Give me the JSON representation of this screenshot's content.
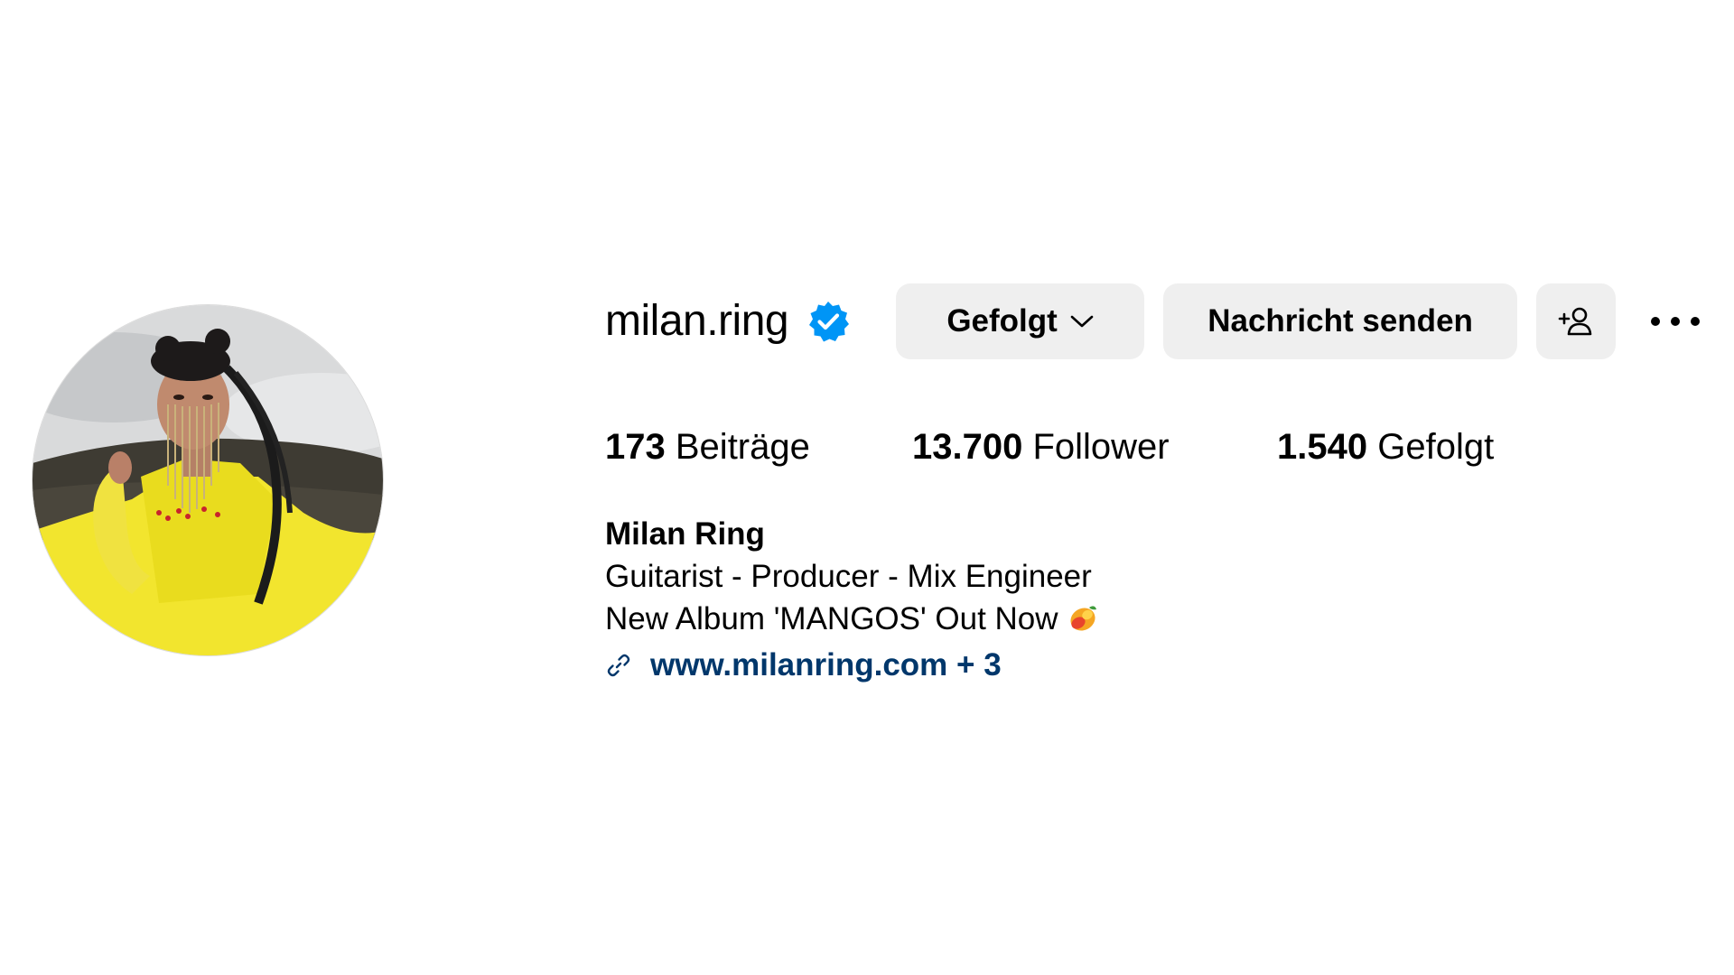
{
  "profile": {
    "username": "milan.ring",
    "verified": true,
    "full_name": "Milan Ring",
    "bio_lines": [
      "Guitarist - Producer - Mix Engineer",
      "New Album 'MANGOS' Out Now"
    ],
    "bio_emoji_icon": "mango-emoji-icon",
    "link_text": "www.milanring.com + 3"
  },
  "actions": {
    "follow_label": "Gefolgt",
    "message_label": "Nachricht senden",
    "add_user_icon": "add-user-icon",
    "more_icon": "more-options-icon"
  },
  "stats": {
    "posts_count": "173",
    "posts_label": "Beiträge",
    "followers_count": "13.700",
    "followers_label": "Follower",
    "following_count": "1.540",
    "following_label": "Gefolgt"
  },
  "colors": {
    "verified_blue": "#0095f6",
    "link_blue": "#00376b",
    "button_bg": "#efefef",
    "avatar_yellow": "#f2e52e"
  }
}
